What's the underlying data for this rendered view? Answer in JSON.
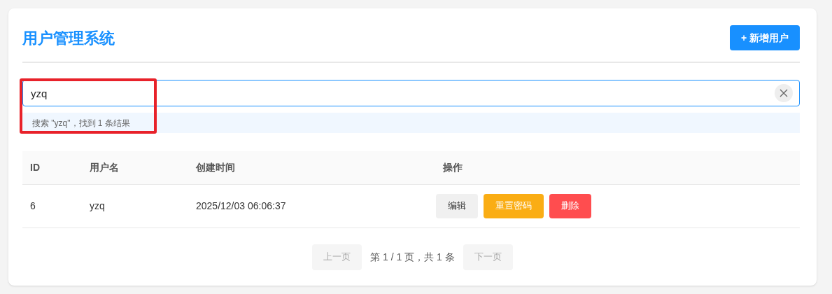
{
  "header": {
    "title": "用户管理系统",
    "add_button": "+ 新增用户"
  },
  "search": {
    "value": "yzq",
    "focused": true,
    "result_hint": "搜索 \"yzq\"，找到 1 条结果"
  },
  "table": {
    "columns": [
      "ID",
      "用户名",
      "创建时间",
      "操作"
    ],
    "rows": [
      {
        "id": "6",
        "username": "yzq",
        "created": "2025/12/03 06:06:37",
        "actions": [
          {
            "label": "编辑",
            "kind": "default"
          },
          {
            "label": "重置密码",
            "kind": "warning"
          },
          {
            "label": "删除",
            "kind": "danger"
          }
        ]
      }
    ]
  },
  "pagination": {
    "prev": {
      "label": "上一页",
      "disabled": true
    },
    "info": "第 1 / 1 页，共 1 条",
    "next": {
      "label": "下一页",
      "disabled": true
    }
  }
}
